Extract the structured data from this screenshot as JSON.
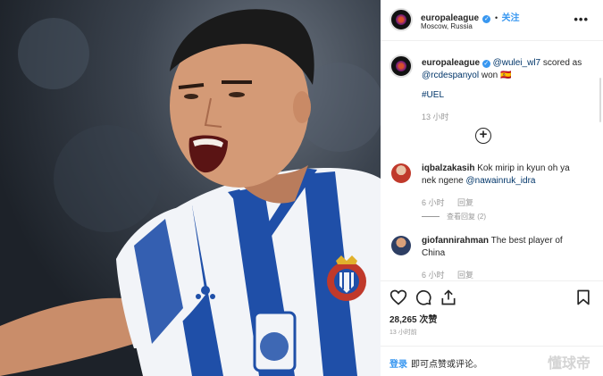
{
  "header": {
    "username": "europaleague",
    "verified_mark": "✓",
    "separator": "•",
    "follow_label": "关注",
    "location": "Moscow, Russia",
    "more_label": "•••"
  },
  "post": {
    "username": "europaleague",
    "caption_parts": [
      "@wulei_wl7",
      " scored as ",
      "@rcdespanyol",
      " won ",
      "🇪🇸"
    ],
    "hashtag": "#UEL",
    "time_ago": "13 小时",
    "load_more_label": "+"
  },
  "comments": [
    {
      "username": "iqbalzakasih",
      "text": "Kok mirip in kyun oh ya nek ngene",
      "mention": "@nawainruk_idra",
      "time_ago": "6 小时",
      "reply_label": "回复",
      "view_replies_label": "查看回复 (2)"
    },
    {
      "username": "giofannirahman",
      "text": "The best player of China",
      "time_ago": "6 小时",
      "reply_label": "回复"
    }
  ],
  "actions": {
    "like_icon": "heart-icon",
    "comment_icon": "comment-icon",
    "share_icon": "share-icon",
    "save_icon": "bookmark-icon"
  },
  "likes": "28,265 次赞",
  "post_time": "13 小时前",
  "login": {
    "link_label": "登录",
    "prompt": "即可点赞或评论。"
  },
  "watermark": "懂球帝",
  "photo": {
    "crest_text": "RCD ESPANYOL DE BARCELONA"
  },
  "colors": {
    "accent": "#3897f0",
    "mention": "#003569",
    "muted": "#999999",
    "border": "#efefef",
    "kit_blue": "#1f4fa8"
  }
}
